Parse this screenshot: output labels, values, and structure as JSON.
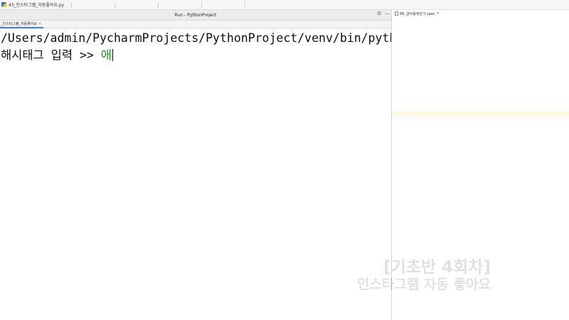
{
  "editor": {
    "file_tab": "43_인스타그램_자동좋아요.py"
  },
  "run_panel": {
    "title": "Run - PythonProject",
    "tab_label": "_인스타그램_자동좋아요",
    "command_line": "/Users/admin/PycharmProjects/PythonProject/venv/bin/python /User",
    "prompt": "해시태그 입력 >> ",
    "input_value": "애"
  },
  "right_panel": {
    "spec_tab": "68_글자음계산기.spec"
  },
  "watermark": {
    "line1": "[기초반 4회차]",
    "line2": "인스타그램 자동 좋아요"
  }
}
